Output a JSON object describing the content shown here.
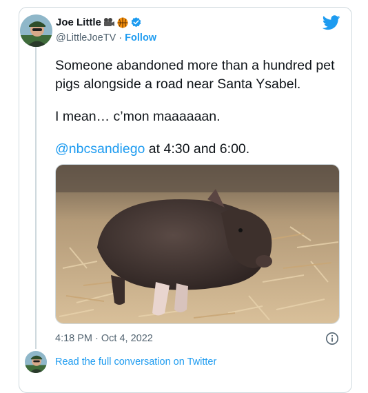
{
  "author": {
    "display_name": "Joe Little",
    "handle": "@LittleJoeTV",
    "separator": "·",
    "follow_label": "Follow",
    "emojis": [
      "movie-camera-icon",
      "basketball-icon"
    ],
    "verified": true
  },
  "tweet": {
    "paragraph1": "Someone abandoned more than a hundred pet pigs alongside a road near Santa Ysabel.",
    "paragraph2": "I mean… c’mon maaaaaan.",
    "mention": "@nbcsandiego",
    "paragraph3_rest": " at 4:30 and 6:00.",
    "timestamp": "4:18 PM · Oct 4, 2022"
  },
  "footer": {
    "read_more_label": "Read the full conversation on Twitter"
  },
  "colors": {
    "accent": "#1d9bf0",
    "text": "#0f1419",
    "secondary": "#536471",
    "border": "#cfd9de"
  },
  "icons": {
    "brand": "twitter-bird-icon",
    "verified": "verified-badge-icon",
    "info": "info-icon"
  }
}
